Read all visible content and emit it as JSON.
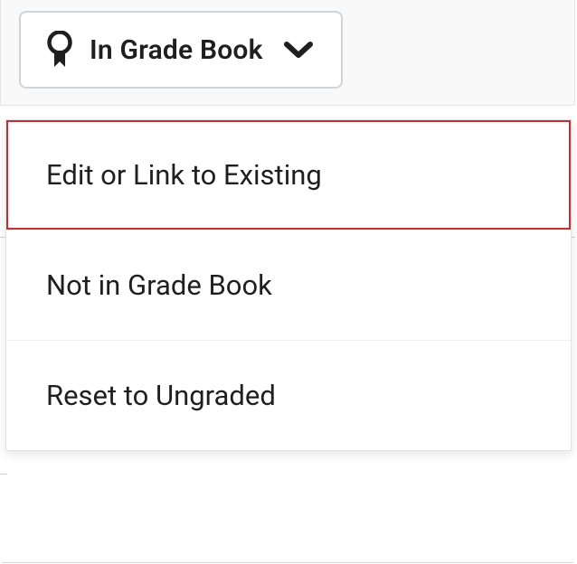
{
  "dropdown": {
    "label": "In Grade Book"
  },
  "menu": {
    "items": [
      {
        "label": "Edit or Link to Existing",
        "highlighted": true
      },
      {
        "label": "Not in Grade Book",
        "highlighted": false
      },
      {
        "label": "Reset to Ungraded",
        "highlighted": false
      }
    ]
  }
}
